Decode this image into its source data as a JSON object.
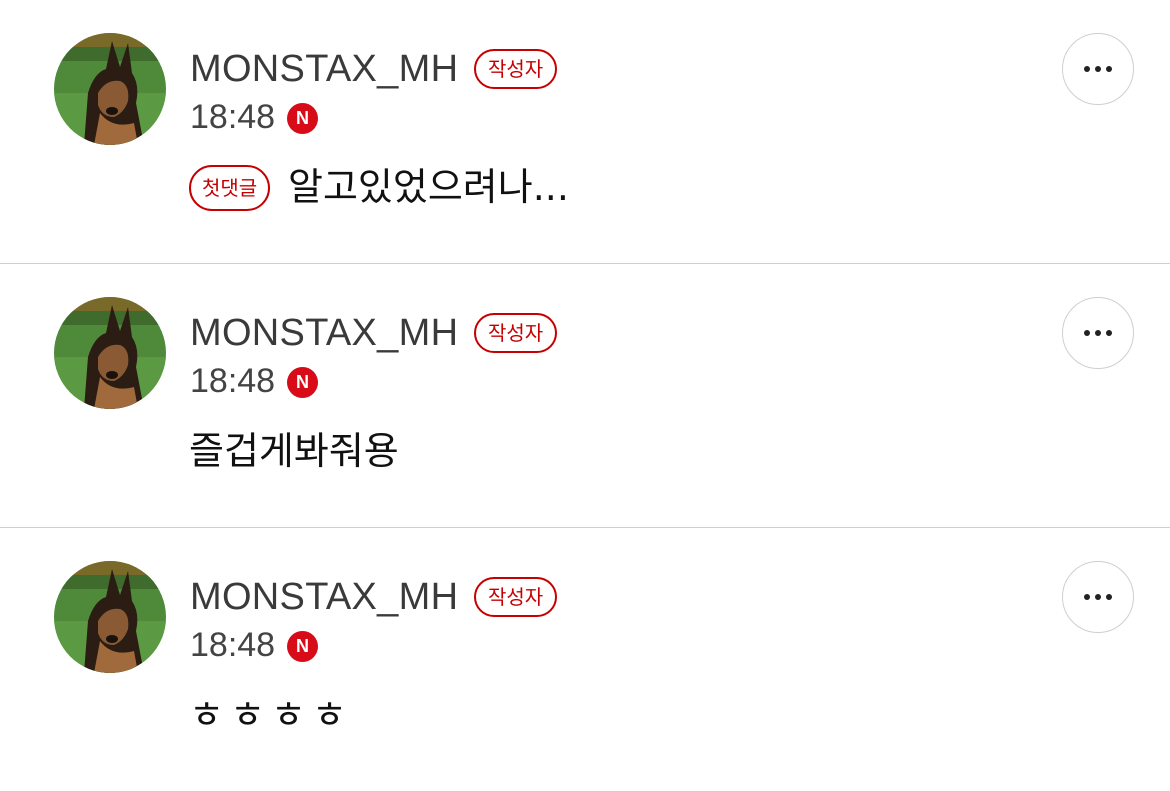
{
  "comments": [
    {
      "username": "MONSTAX_MH",
      "author_badge": "작성자",
      "time": "18:48",
      "n_icon": "N",
      "first_comment_badge": "첫댓글",
      "text": "알고있었으려나..."
    },
    {
      "username": "MONSTAX_MH",
      "author_badge": "작성자",
      "time": "18:48",
      "n_icon": "N",
      "text": "즐겁게봐줘용"
    },
    {
      "username": "MONSTAX_MH",
      "author_badge": "작성자",
      "time": "18:48",
      "n_icon": "N",
      "text": "ㅎㅎㅎㅎ"
    }
  ],
  "colors": {
    "accent_red": "#c60000",
    "n_icon_bg": "#d80c18",
    "divider": "#cfcfcf",
    "username_text": "#3a3a3a"
  },
  "icons": {
    "more": "more-dots-icon",
    "naver": "naver-n-icon",
    "avatar": "dog-avatar"
  }
}
